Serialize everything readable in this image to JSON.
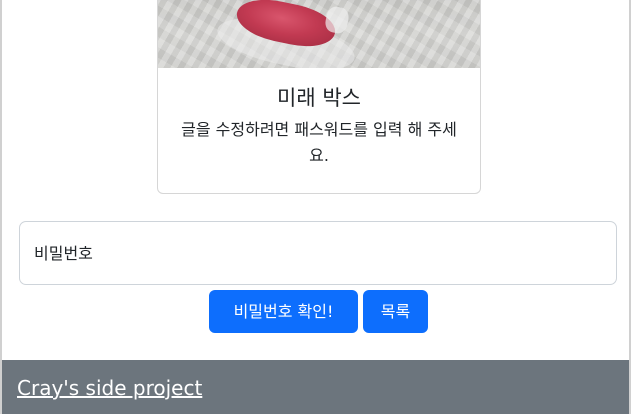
{
  "card": {
    "image_name": "hourglass-image",
    "title": "미래 박스",
    "description": "글을 수정하려면 패스워드를 입력 해 주세요."
  },
  "password_input": {
    "placeholder": "비밀번호",
    "value": ""
  },
  "buttons": {
    "confirm_label": "비밀번호 확인!",
    "list_label": "목록"
  },
  "footer": {
    "link_text": "Cray's side project"
  },
  "colors": {
    "primary": "#0d6efd",
    "footer_bg": "#6c757d",
    "sand": "#c23a52"
  }
}
